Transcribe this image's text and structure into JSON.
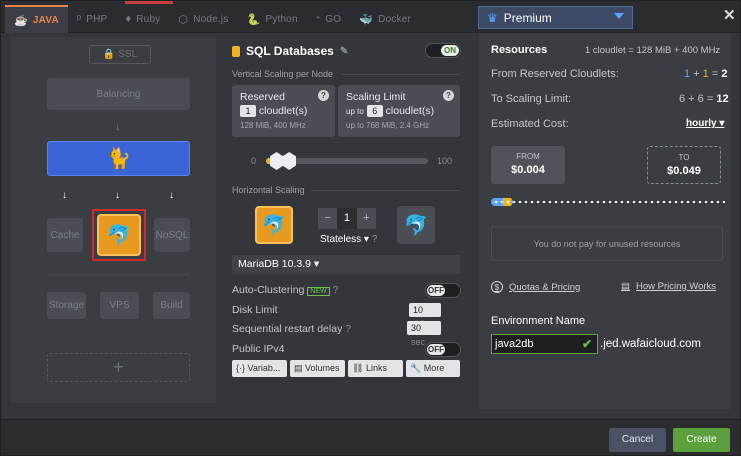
{
  "tabs": [
    {
      "label": "JAVA",
      "icon": "java-icon"
    },
    {
      "label": "PHP",
      "icon": "php-icon"
    },
    {
      "label": "Ruby",
      "icon": "ruby-icon"
    },
    {
      "label": "Node.js",
      "icon": "nodejs-icon"
    },
    {
      "label": "Python",
      "icon": "python-icon"
    },
    {
      "label": "GO",
      "icon": "go-icon"
    },
    {
      "label": "Docker",
      "icon": "docker-icon"
    }
  ],
  "region": {
    "label": "Premium"
  },
  "topology": {
    "ssl": "SSL",
    "balancing": "Balancing",
    "cache": "Cache",
    "nosql": "NoSQL",
    "storage": "Storage",
    "vps": "VPS",
    "build": "Build",
    "add": "+"
  },
  "layer": {
    "title": "SQL Databases",
    "toggle": "ON",
    "vertical_label": "Vertical Scaling per Node",
    "reserved": {
      "title": "Reserved",
      "value": "1",
      "unit": "cloudlet(s)",
      "sub": "128 MiB, 400 MHz"
    },
    "limit": {
      "title": "Scaling Limit",
      "prefix": "up to",
      "value": "6",
      "unit": "cloudlet(s)",
      "sub": "up to 768 MiB, 2.4 GHz"
    },
    "slider": {
      "min": "0",
      "max": "100",
      "reserved": 1,
      "limit": 6
    },
    "horizontal_label": "Horizontal Scaling",
    "nodes": "1",
    "minus": "−",
    "plus": "+",
    "mode": "Stateless",
    "version": "MariaDB 10.3.9",
    "auto_clustering": {
      "label": "Auto-Clustering",
      "badge": "NEW",
      "toggle": "OFF"
    },
    "disk": {
      "label": "Disk Limit",
      "value": "10",
      "unit": "GB"
    },
    "restart": {
      "label": "Sequential restart delay",
      "value": "30",
      "unit": "sec"
    },
    "ipv4": {
      "label": "Public IPv4",
      "toggle": "OFF"
    },
    "buttons": [
      "Variab...",
      "Volumes",
      "Links",
      "More"
    ]
  },
  "resources": {
    "title": "Resources",
    "cloudlet_def": "1 cloudlet = 128 MiB + 400 MHz",
    "from_label": "From Reserved Cloudlets:",
    "from_a": "1",
    "from_b": "1",
    "from_total": "2",
    "to_label": "To Scaling Limit:",
    "to_a": "6",
    "to_b": "6",
    "to_total": "12",
    "cost_label": "Estimated Cost:",
    "period": "hourly",
    "from_cap": "FROM",
    "from_price": "$0.004",
    "to_cap": "TO",
    "to_price": "$0.049",
    "info": "You do not pay for unused resources",
    "quotas": "Quotas & Pricing",
    "how": "How Pricing Works",
    "env_label": "Environment Name",
    "env_name": "java2db",
    "domain": ".jed.wafaicloud.com"
  },
  "footer": {
    "cancel": "Cancel",
    "create": "Create"
  }
}
